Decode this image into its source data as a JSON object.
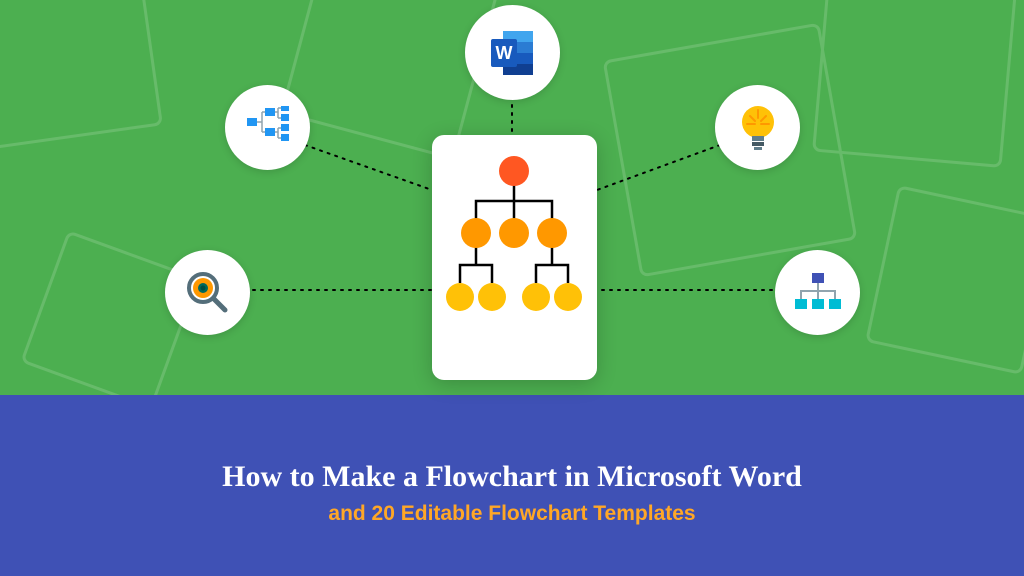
{
  "title": "How to Make a Flowchart in Microsoft Word",
  "subtitle": "and 20 Editable Flowchart Templates",
  "icons": {
    "top": "word-icon",
    "top_left": "org-chart-icon",
    "top_right": "lightbulb-icon",
    "bottom_left": "magnifier-icon",
    "bottom_right": "hierarchy-icon"
  },
  "colors": {
    "green": "#4caf50",
    "blue": "#3f51b5",
    "accent": "#ffa726"
  }
}
